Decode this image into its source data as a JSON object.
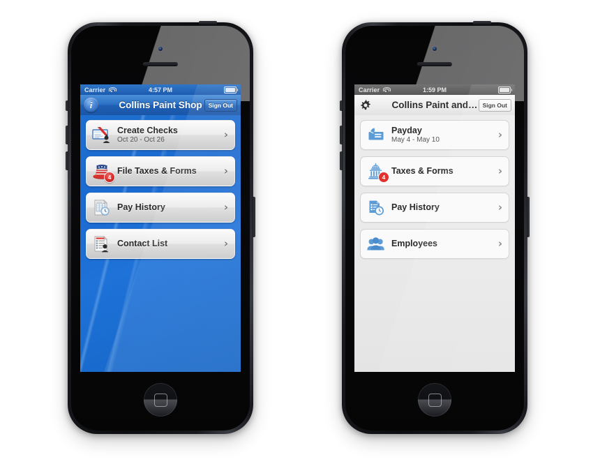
{
  "scene": {
    "description": "Two iPhone 5 mockups side by side showing a payroll app home screen in old and new visual styles"
  },
  "phones": [
    {
      "id": "left",
      "theme": "blue-glossy",
      "status_bar": {
        "carrier": "Carrier",
        "wifi_icon": "wifi-icon",
        "time": "4:57 PM",
        "battery_icon": "battery-full-icon"
      },
      "nav_bar": {
        "left_icon": "info-icon",
        "left_icon_label": "i",
        "title": "Collins Paint Shop",
        "signout_label": "Sign Out"
      },
      "rows": [
        {
          "icon": "check-with-pen-icon",
          "title": "Create Checks",
          "subtitle": "Oct 20 - Oct 26",
          "badge": "",
          "chevron": "›"
        },
        {
          "icon": "uncle-sam-hat-icon",
          "title": "File Taxes & Forms",
          "subtitle": "",
          "badge": "4",
          "chevron": "›"
        },
        {
          "icon": "pay-history-icon",
          "title": "Pay History",
          "subtitle": "",
          "badge": "",
          "chevron": "›"
        },
        {
          "icon": "contact-list-icon",
          "title": "Contact List",
          "subtitle": "",
          "badge": "",
          "chevron": "›"
        }
      ]
    },
    {
      "id": "right",
      "theme": "light-flat",
      "status_bar": {
        "carrier": "Carrier",
        "wifi_icon": "wifi-icon",
        "time": "1:59 PM",
        "battery_icon": "battery-full-icon"
      },
      "nav_bar": {
        "left_icon": "gear-icon",
        "left_icon_label": "",
        "title": "Collins Paint and…",
        "signout_label": "Sign Out"
      },
      "rows": [
        {
          "icon": "check-with-pen-icon",
          "title": "Payday",
          "subtitle": "May 4 - May 10",
          "badge": "",
          "chevron": "›"
        },
        {
          "icon": "capitol-building-icon",
          "title": "Taxes & Forms",
          "subtitle": "",
          "badge": "4",
          "chevron": "›"
        },
        {
          "icon": "pay-history-icon",
          "title": "Pay History",
          "subtitle": "",
          "badge": "",
          "chevron": "›"
        },
        {
          "icon": "employees-icon",
          "title": "Employees",
          "subtitle": "",
          "badge": "",
          "chevron": "›"
        }
      ]
    }
  ],
  "colors": {
    "blue_nav": "#2a6fc4",
    "blue_body": "#1b6ad1",
    "light_body": "#e9e9e9",
    "badge_red": "#d62a28",
    "flat_icon_blue": "#5b9bd8",
    "text_dark": "#2b2b2b"
  }
}
